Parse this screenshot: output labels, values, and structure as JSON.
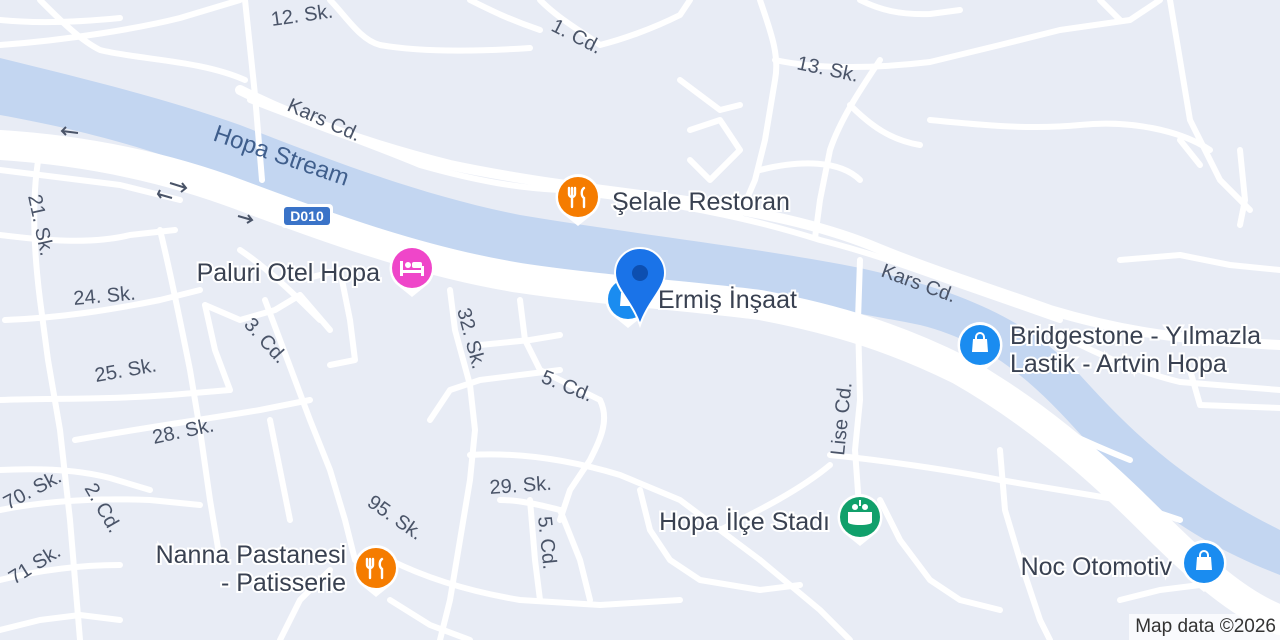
{
  "map": {
    "water_label": "Hopa Stream",
    "highway_shield": "D010",
    "attribution": "Map data ©2026",
    "colors": {
      "land": "#e8ecf5",
      "water": "#c3d6f1",
      "road": "#ffffff",
      "restaurant": "#f57c00",
      "hotel": "#ef46c9",
      "shopping": "#1a8cf0",
      "stadium": "#11a06b",
      "pin": "#1a73e8"
    }
  },
  "roads": {
    "sk12": "12. Sk.",
    "cd1": "1. Cd.",
    "sk13": "13. Sk.",
    "kars1": "Kars Cd.",
    "kars2": "Kars Cd.",
    "sk21": "21. Sk.",
    "sk24": "24. Sk.",
    "cd3": "3. Cd.",
    "sk32": "32. Sk.",
    "sk25": "25. Sk.",
    "cd5a": "5. Cd.",
    "sk28": "28. Sk.",
    "lise": "Lise Cd.",
    "sk29": "29. Sk.",
    "sk70": "70. Sk.",
    "cd2": "2. Cd.",
    "sk95": "95. Sk.",
    "cd5b": "5. Cd.",
    "sk71": "71 Sk."
  },
  "pois": {
    "selale": {
      "name": "Şelale Restoran",
      "icon": "restaurant-icon"
    },
    "paluri": {
      "name": "Paluri Otel Hopa",
      "icon": "hotel-icon"
    },
    "ermis": {
      "name": "Ermiş İnşaat",
      "icon": "shopping-bag-icon"
    },
    "bridgestone": {
      "line1": "Bridgestone - Yılmazla",
      "line2": "Lastik - Artvin Hopa",
      "icon": "shopping-bag-icon"
    },
    "stadi": {
      "name": "Hopa İlçe Stadı",
      "icon": "stadium-icon"
    },
    "nanna": {
      "line1": "Nanna Pastanesi",
      "line2": "- Patisserie",
      "icon": "restaurant-icon"
    },
    "noc": {
      "name": "Noc Otomotiv",
      "icon": "shopping-bag-icon"
    }
  }
}
